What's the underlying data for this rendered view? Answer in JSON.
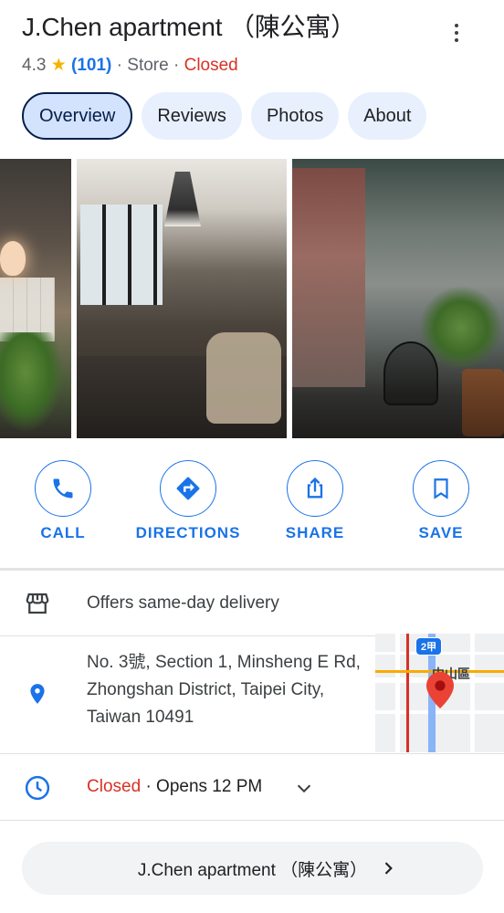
{
  "place": {
    "title": "J.Chen apartment （陳公寓）",
    "rating": "4.3",
    "star": "★",
    "review_count": "(101)",
    "separator_1": "·",
    "category": "Store",
    "separator_2": "·",
    "status": "Closed"
  },
  "tabs": [
    {
      "label": "Overview",
      "active": true
    },
    {
      "label": "Reviews",
      "active": false
    },
    {
      "label": "Photos",
      "active": false
    },
    {
      "label": "About",
      "active": false
    }
  ],
  "actions": {
    "call": "CALL",
    "directions": "DIRECTIONS",
    "share": "SHARE",
    "save": "SAVE"
  },
  "details": {
    "delivery": "Offers same-day delivery",
    "address": "No. 3號, Section 1, Minsheng E Rd, Zhongshan District, Taipei City, Taiwan 10491",
    "hours_status": "Closed",
    "hours_separator": "·",
    "hours_next": "Opens 12 PM"
  },
  "map": {
    "route_shield": "2甲",
    "area_label": "中山區"
  },
  "bottom_bar": {
    "label": "J.Chen apartment （陳公寓）"
  },
  "colors": {
    "accent": "#1a73e8",
    "closed": "#d93025",
    "star": "#f4b400",
    "tab_bg": "#e8f0fe",
    "tab_active_bg": "#d3e3fd"
  },
  "icons": {
    "more": "more-vert-icon",
    "call": "phone-icon",
    "directions": "directions-icon",
    "share": "share-icon",
    "save": "bookmark-icon",
    "delivery": "storefront-icon",
    "address": "location-pin-icon",
    "hours": "clock-icon",
    "expand": "chevron-down-icon",
    "bottom": "chevron-right-icon"
  }
}
